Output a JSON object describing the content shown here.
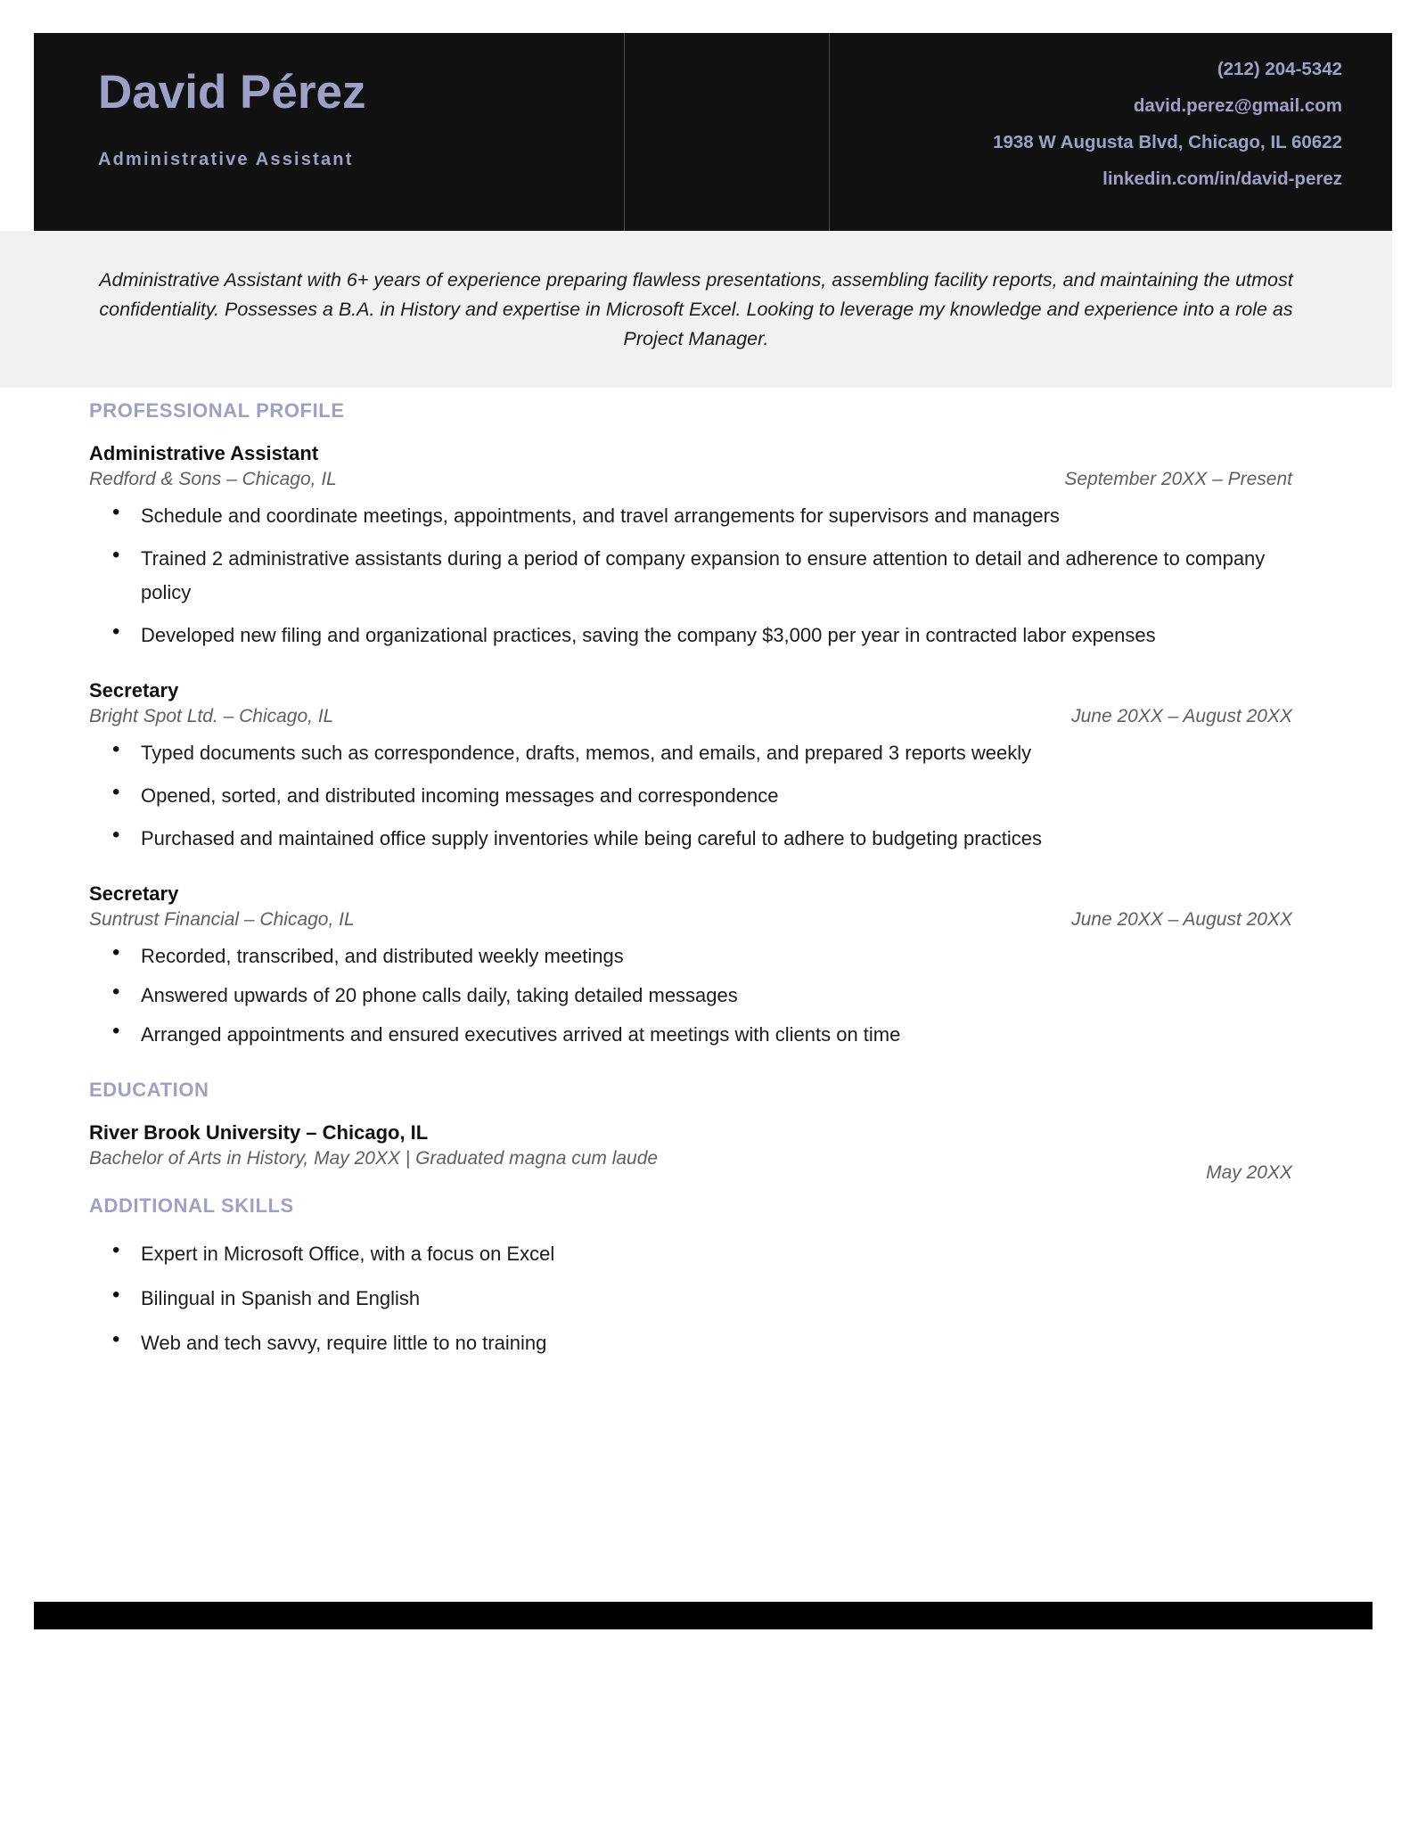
{
  "header": {
    "name": "David Pérez",
    "job_title": "Administrative Assistant",
    "contact": {
      "phone": "(212) 204-5342",
      "email": "david.perez@gmail.com",
      "address": "1938 W Augusta Blvd, Chicago, IL 60622",
      "linkedin": "linkedin.com/in/david-perez"
    }
  },
  "summary": {
    "text": "Administrative Assistant with 6+ years of experience preparing flawless presentations, assembling facility reports, and maintaining the utmost confidentiality. Possesses a B.A. in History and expertise in Microsoft Excel. Looking to leverage my knowledge and experience into a role as Project Manager."
  },
  "sections": {
    "profile_heading": "PROFESSIONAL PROFILE",
    "education_heading": "EDUCATION",
    "skills_heading": "ADDITIONAL SKILLS"
  },
  "experience": [
    {
      "title": "Administrative Assistant",
      "org": "Redford & Sons – Chicago, IL",
      "dates": "September 20XX – Present",
      "bullets": [
        "Schedule and coordinate meetings, appointments, and travel arrangements for supervisors and managers",
        "Trained 2 administrative assistants during a period of company expansion to ensure attention to detail and adherence to company policy",
        "Developed new filing and organizational practices, saving the company $3,000 per year in contracted labor expenses"
      ]
    },
    {
      "title": "Secretary",
      "org": "Bright Spot Ltd. – Chicago, IL",
      "dates": "June 20XX – August 20XX",
      "bullets": [
        "Typed documents such as correspondence, drafts, memos, and emails, and prepared 3 reports weekly",
        "Opened, sorted, and distributed incoming messages and correspondence",
        "Purchased and maintained office supply inventories while being careful to adhere to budgeting practices"
      ]
    },
    {
      "title": "Secretary",
      "org": "Suntrust Financial – Chicago, IL",
      "dates": "June 20XX – August 20XX",
      "bullets": [
        "Recorded, transcribed, and distributed weekly meetings",
        "Answered upwards of 20 phone calls daily, taking detailed messages",
        "Arranged appointments and ensured executives arrived at meetings with clients on time"
      ]
    }
  ],
  "education": {
    "school": "River Brook University – Chicago, IL",
    "degree": "Bachelor of Arts in History, May 20XX | Graduated magna cum laude",
    "date": "May 20XX"
  },
  "skills": [
    "Expert in Microsoft Office, with a focus on Excel",
    "Bilingual in Spanish and English",
    "Web and tech savvy, require little to no training"
  ],
  "colors": {
    "accent": "#9fa0c8",
    "header_bg": "#111111",
    "band_bg": "#f1f1f1",
    "body_text": "#1c1c1c",
    "muted_text": "#5f5f5f"
  }
}
